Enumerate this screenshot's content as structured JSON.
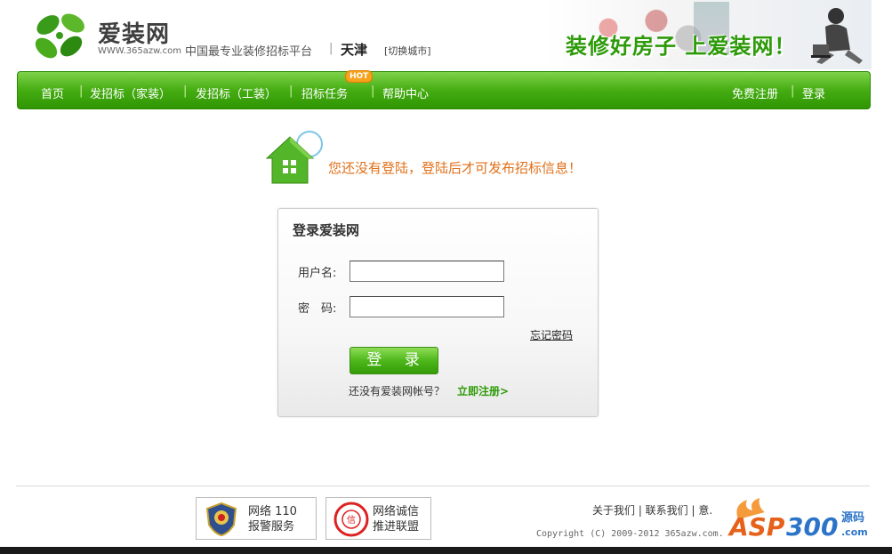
{
  "header": {
    "logo_text": "爱装网",
    "logo_url": "WWW.365azw.com",
    "slogan": "中国最专业装修招标平台",
    "separator": "|",
    "city": "天津",
    "switch_city": "[切换城市]",
    "banner_text": "装修好房子 上爱装网！"
  },
  "nav": {
    "items": [
      {
        "label": "首页"
      },
      {
        "label": "发招标（家装）"
      },
      {
        "label": "发招标（工装）"
      },
      {
        "label": "招标任务"
      },
      {
        "label": "帮助中心"
      }
    ],
    "hot_badge": "HOT",
    "register": "免费注册",
    "login": "登录"
  },
  "notice": "您还没有登陆，登陆后才可发布招标信息！",
  "login_box": {
    "title": "登录爱装网",
    "username_label": "用户名:",
    "password_label": "密　码:",
    "username_value": "",
    "password_value": "",
    "forgot": "忘记密码",
    "submit": "登 录",
    "no_account": "还没有爱装网帐号？",
    "register_link": "立即注册>"
  },
  "footer": {
    "badge1_line1": "网络 110",
    "badge1_line2": "报警服务",
    "badge2_line1": "网络诚信",
    "badge2_line2": "推进联盟",
    "links": "关于我们 | 联系我们 | 意.",
    "copyright": "Copyright (C) 2009-2012 365azw.com.",
    "watermark": "ASP300 源码 .com"
  },
  "colors": {
    "nav_green": "#45ad12",
    "notice_orange": "#e0701a",
    "link_green": "#2e9b06"
  }
}
